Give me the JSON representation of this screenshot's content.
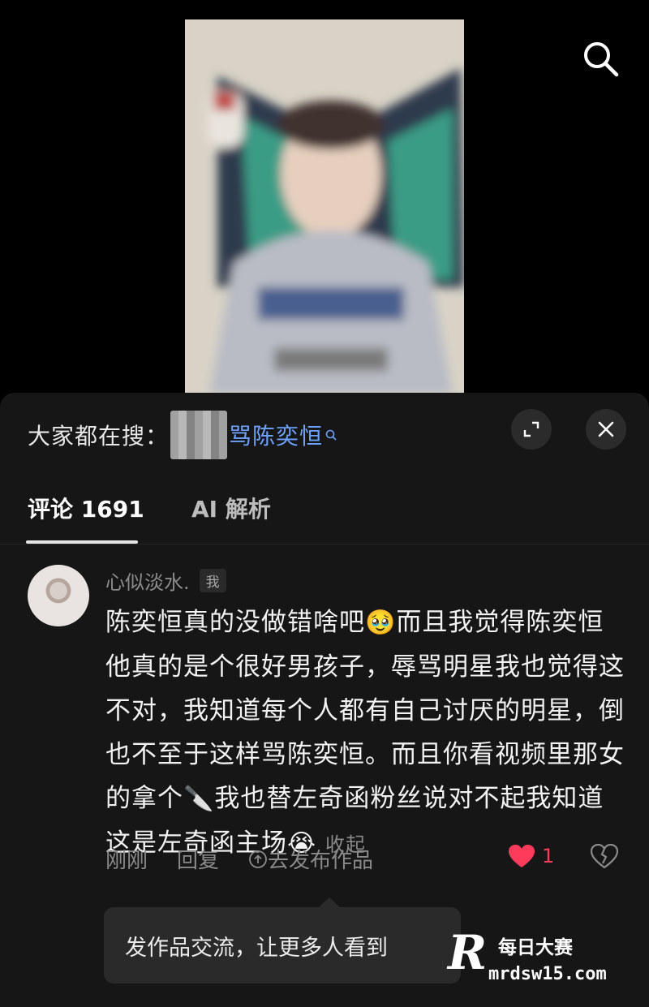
{
  "search_bar": {
    "prefix": "大家都在搜：",
    "query_visible": "骂陈奕恒"
  },
  "tabs": [
    {
      "label": "评论 1691",
      "active": true
    },
    {
      "label": "AI 解析",
      "active": false
    }
  ],
  "comment": {
    "username": "心似淡水.",
    "badge": "我",
    "text_part1": "陈奕恒真的没做错啥吧",
    "text_part2": "而且我觉得陈奕恒他真的是个很好男孩子，辱骂明星我也觉得这不对，我知道每个人都有自己讨厌的明星，倒也不至于这样骂陈奕恒。而且你看视频里那女的拿个",
    "text_part3": "我也替左奇函粉丝说对不起我知道这是左奇函主场",
    "emoji_1": "🥹",
    "emoji_knife": "🔪",
    "emoji_2": "😭",
    "collapse_label": "收起",
    "time": "刚刚",
    "reply_label": "回复",
    "publish_label": "去发布作品",
    "like_count": "1"
  },
  "tooltip": {
    "text": "发作品交流，让更多人看到"
  },
  "watermark": {
    "title": "每日大赛",
    "url": "mrdsw15.com"
  },
  "colors": {
    "accent_link": "#6ea2ff",
    "like_red": "#ff3b5c",
    "sheet_bg": "#161616"
  },
  "icons": [
    "search-icon",
    "expand-icon",
    "close-icon",
    "heart-icon",
    "broken-heart-icon",
    "upload-icon"
  ]
}
